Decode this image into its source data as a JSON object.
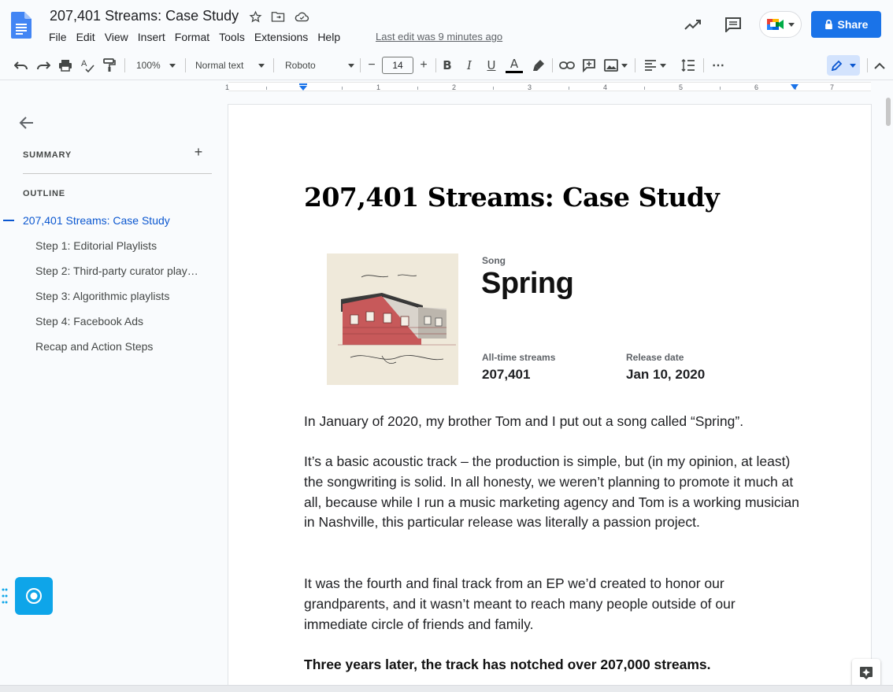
{
  "header": {
    "doc_title": "207,401 Streams: Case Study",
    "menu": [
      "File",
      "Edit",
      "View",
      "Insert",
      "Format",
      "Tools",
      "Extensions",
      "Help"
    ],
    "last_edit": "Last edit was 9 minutes ago",
    "share_label": "Share"
  },
  "toolbar": {
    "zoom": "100%",
    "style": "Normal text",
    "font": "Roboto",
    "font_size": "14",
    "minus": "−",
    "plus": "+",
    "bold": "B",
    "italic": "I",
    "underline": "U",
    "text_color": "A",
    "more": "⋯"
  },
  "ruler": {
    "numbers": [
      "1",
      "1",
      "2",
      "3",
      "4",
      "5",
      "6",
      "7"
    ]
  },
  "sidebar": {
    "summary_label": "SUMMARY",
    "summary_add": "+",
    "outline_label": "OUTLINE",
    "outline": [
      "207,401 Streams: Case Study",
      "Step 1: Editorial Playlists",
      "Step 2: Third-party curator play…",
      "Step 3: Algorithmic playlists",
      "Step 4: Facebook Ads",
      "Recap and Action Steps"
    ]
  },
  "document": {
    "heading": "207,401 Streams: Case Study",
    "song_label": "Song",
    "song_title": "Spring",
    "streams_label": "All-time streams",
    "streams_value": "207,401",
    "release_label": "Release date",
    "release_value": "Jan 10, 2020",
    "paragraphs": [
      "In January of 2020, my brother Tom and I put out a song called “Spring”.",
      "It’s a basic acoustic track – the production is simple, but (in my opinion, at least) the songwriting is solid. In all honesty, we weren’t planning to promote it much at all, because while I run a music marketing agency and Tom is a working musician in Nashville, this particular release was literally a passion project.",
      "It was the fourth and final track from an EP we’d created to honor our grandparents, and it wasn’t meant to reach many people outside of our immediate circle of friends and family.",
      "Three years later, the track has notched over 207,000 streams."
    ]
  },
  "colors": {
    "accent": "#1a73e8",
    "outline_active": "#0b57d0",
    "record_button": "#0ea5e9"
  }
}
